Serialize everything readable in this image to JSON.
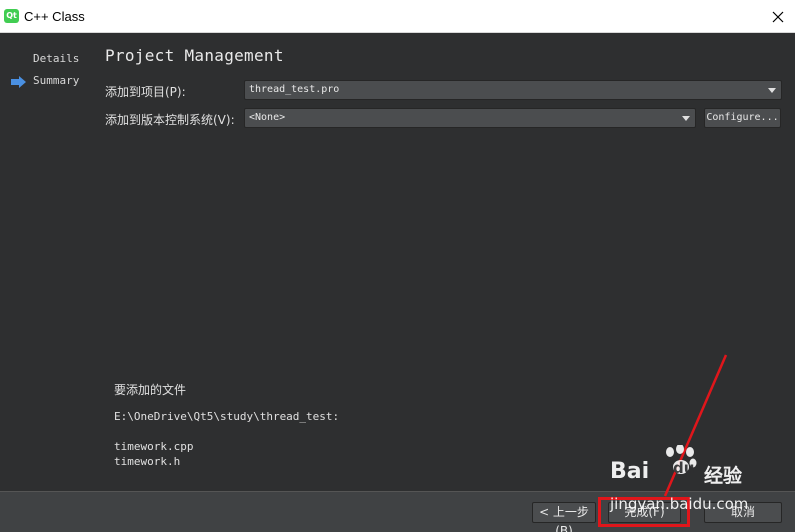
{
  "window": {
    "title": "C++ Class",
    "logo_text": "Qt"
  },
  "sidebar": {
    "items": [
      {
        "label": "Details",
        "active": false
      },
      {
        "label": "Summary",
        "active": true
      }
    ]
  },
  "main": {
    "page_title": "Project Management",
    "fields": [
      {
        "label": "添加到项目(P):",
        "value": "thread_test.pro"
      },
      {
        "label": "添加到版本控制系统(V):",
        "value": "<None>"
      }
    ],
    "configure_label": "Configure...",
    "files_title": "要添加的文件",
    "files_path": "E:\\OneDrive\\Qt5\\study\\thread_test:",
    "files": [
      "timework.cpp",
      "timework.h"
    ]
  },
  "footer": {
    "back_label": "< 上一步(B)",
    "finish_label": "完成(F)",
    "cancel_label": "取消"
  },
  "watermark": {
    "brand": "Bai",
    "brand2": "du",
    "cn": "经验",
    "url": "jingyan.baidu.com"
  },
  "colors": {
    "background": "#404244",
    "panel": "#2e2f30",
    "annotation": "#e0161b",
    "sidebar_arrow": "#4a90e2"
  }
}
